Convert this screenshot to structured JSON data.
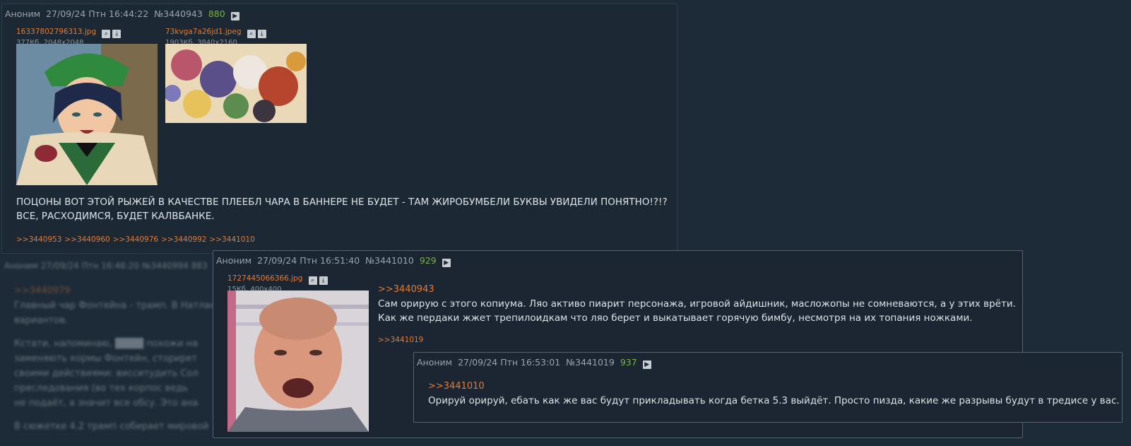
{
  "post1": {
    "author": "Аноним",
    "datetime": "27/09/24 Птн 16:44:22",
    "number": "№3440943",
    "likes": "880",
    "files": [
      {
        "name": "16337802796313.jpg",
        "meta": "377Кб, 2048x2048"
      },
      {
        "name": "73kvga7a26jd1.jpeg",
        "meta": "1903Кб, 3840x2160"
      }
    ],
    "text_lines": [
      "ПОЦОНЫ ВОТ ЭТОЙ РЫЖЕЙ В КАЧЕСТВЕ ПЛЕЕБЛ ЧАРА В БАННЕРЕ НЕ БУДЕТ - ТАМ ЖИРОБУМБЕЛИ БУКВЫ УВИДЕЛИ ПОНЯТНО!?!?",
      "ВСЕ, РАСХОДИМСЯ, БУДЕТ КАЛВБАНКЕ."
    ],
    "replies": [
      ">>3440953",
      ">>3440960",
      ">>3440976",
      ">>3440992",
      ">>3441010"
    ]
  },
  "background_post": {
    "header": "Аноним 27/09/24 Птн 16:46:20 №3440994 883",
    "reply": ">>3440979",
    "lines": [
      "Главный чар Фонтейна - трамп. В Натлане",
      "вариантов.",
      "",
      "Кстати, напоминаю, ████ похожи на",
      "заменяють кормы Фонтейн, сторирет",
      "своими действиями: висситудить Сол",
      "преследования (во тех корпос ведь",
      "не подаёт, а значит все обсу. Это ана",
      "",
      "В сюжетке 4.2 трамп собирает мировой"
    ]
  },
  "post2": {
    "author": "Аноним",
    "datetime": "27/09/24 Птн 16:51:40",
    "number": "№3441010",
    "likes": "929",
    "file": {
      "name": "1727445066366.jpg",
      "meta": "15Кб, 400x400"
    },
    "reply_link": ">>3440943",
    "text_lines": [
      "Сам орирую с этого копиума. Ляо активо пиарит персонажа, игровой айдишник, масложопы не сомневаются, а у этих врёти.",
      "Как же пердаки жжет трепилоидкам что ляо берет и выкатывает горячую бимбу, несмотря на их топания ножками."
    ],
    "replies": [
      ">>3441019"
    ]
  },
  "post3": {
    "author": "Аноним",
    "datetime": "27/09/24 Птн 16:53:01",
    "number": "№3441019",
    "likes": "937",
    "reply_link": ">>3441010",
    "text_lines": [
      "Орируй орируй, ебать как же вас будут прикладывать когда бетка 5.3 выйдёт. Просто пизда, какие же разрывы будут в тредисе у вас."
    ]
  },
  "icons": {
    "view": "magnifier-icon",
    "download": "download-icon",
    "play": "play-icon"
  }
}
